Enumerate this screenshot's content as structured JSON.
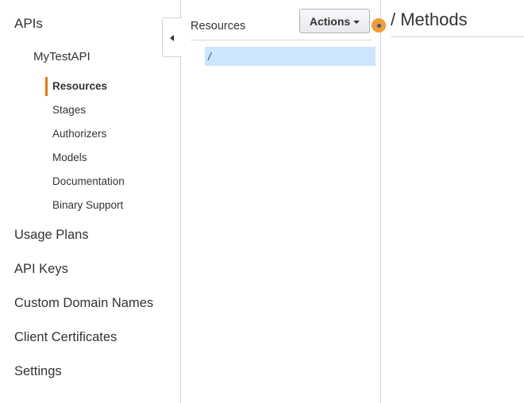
{
  "nav": {
    "apis_label": "APIs",
    "api_name": "MyTestAPI",
    "sub_items": [
      "Resources",
      "Stages",
      "Authorizers",
      "Models",
      "Documentation",
      "Binary Support"
    ],
    "active_sub": "Resources",
    "main_items": [
      "Usage Plans",
      "API Keys",
      "Custom Domain Names",
      "Client Certificates",
      "Settings"
    ]
  },
  "resources": {
    "title": "Resources",
    "actions_label": "Actions",
    "tree": [
      {
        "path": "/"
      }
    ]
  },
  "methods": {
    "title": "/ Methods"
  },
  "colors": {
    "accent": "#e47911",
    "selected_row": "#cde5ff",
    "indicator": "#f29b38"
  }
}
